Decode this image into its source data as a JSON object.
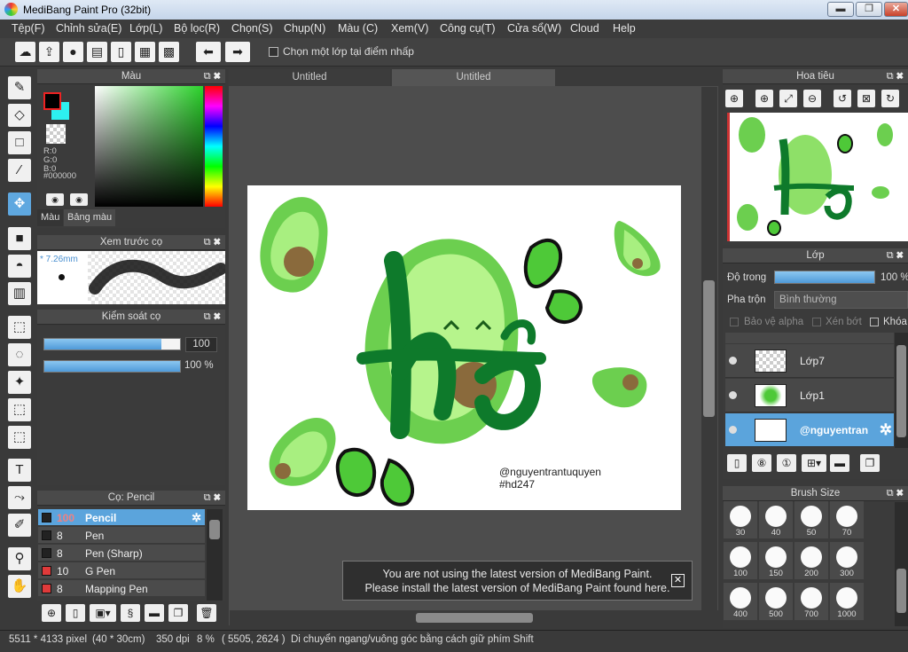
{
  "window": {
    "title": "MediBang Paint Pro (32bit)"
  },
  "menu": [
    "Tệp(F)",
    "Chỉnh sửa(E)",
    "Lớp(L)",
    "Bộ lọc(R)",
    "Chọn(S)",
    "Chụp(N)",
    "Màu (C)",
    "Xem(V)",
    "Công cụ(T)",
    "Cửa sổ(W)",
    "Cloud",
    "Help"
  ],
  "toolbar": {
    "select_layer_checkbox": "Chọn một lớp tại điểm nhấp"
  },
  "color_panel": {
    "title": "Màu",
    "r": "R:0",
    "g": "G:0",
    "b": "B:0",
    "hex": "#000000",
    "tab_color": "Màu",
    "tab_palette": "Bảng màu"
  },
  "brush_preview": {
    "title": "Xem trước cọ",
    "size": "* 7.26mm"
  },
  "brush_control": {
    "title": "Kiểm soát cọ",
    "size_value": "100",
    "opacity_value": "100 %",
    "size_fraction": 0.86,
    "opacity_fraction": 1.0
  },
  "brush_list": {
    "title": "Cọ: Pencil",
    "items": [
      {
        "size": "100",
        "name": "Pencil",
        "color": "#222222"
      },
      {
        "size": "8",
        "name": "Pen",
        "color": "#222222"
      },
      {
        "size": "8",
        "name": "Pen (Sharp)",
        "color": "#222222"
      },
      {
        "size": "10",
        "name": "G Pen",
        "color": "#e03a3a"
      },
      {
        "size": "8",
        "name": "Mapping Pen",
        "color": "#e03a3a"
      }
    ]
  },
  "tabs": [
    "Untitled",
    "Untitled"
  ],
  "artwork": {
    "signature": "@nguyentrantuquyen",
    "hashtag": "#hd247"
  },
  "notification": {
    "line1": "You are not using the latest version of MediBang Paint.",
    "line2": "Please install the latest version of MediBang Paint found here."
  },
  "navigator": {
    "title": "Hoa tiêu"
  },
  "layer_panel": {
    "title": "Lớp",
    "opacity_label": "Độ trong",
    "opacity_value": "100 %",
    "blend_label": "Pha trộn",
    "blend_value": "Bình thường",
    "protect_alpha": "Bảo vệ alpha",
    "clipping": "Xén bớt",
    "lock": "Khóa",
    "layers": [
      {
        "name": "Lớp7",
        "selected": false
      },
      {
        "name": "Lớp1",
        "selected": false
      },
      {
        "name": "@nguyentran",
        "selected": true
      }
    ]
  },
  "brush_size": {
    "title": "Brush Size",
    "values": [
      "30",
      "40",
      "50",
      "70",
      "100",
      "150",
      "200",
      "300",
      "400",
      "500",
      "700",
      "1000"
    ]
  },
  "status": {
    "size_px": "5511 * 4133 pixel",
    "size_cm": "(40 * 30cm)",
    "dpi": "350 dpi",
    "zoom": "8 %",
    "coords": "( 5505, 2624 )",
    "hint": "Di chuyển ngang/vuông góc bằng cách giữ phím Shift"
  }
}
